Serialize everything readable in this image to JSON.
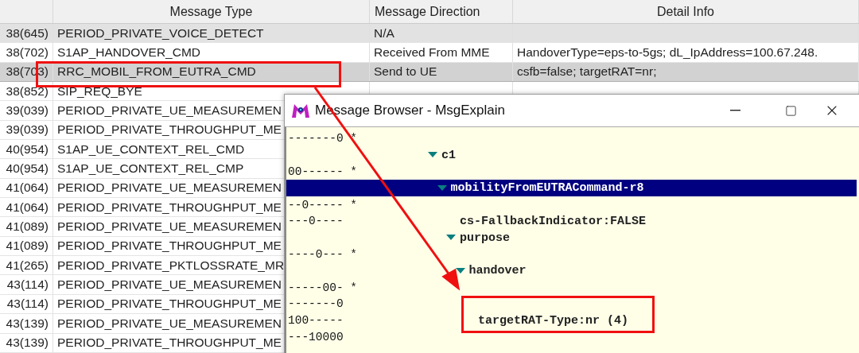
{
  "table": {
    "columns": [
      "Message Type",
      "Message Direction",
      "Detail Info"
    ],
    "rows": [
      {
        "time": "38(645)",
        "type": "PERIOD_PRIVATE_VOICE_DETECT",
        "direction": "N/A",
        "highlighted": true,
        "selected": false
      },
      {
        "time": "38(702)",
        "type": "S1AP_HANDOVER_CMD",
        "direction": "Received From MME",
        "detail": "HandoverType=eps-to-5gs; dL_IpAddress=100.67.248.",
        "highlighted": false,
        "selected": false
      },
      {
        "time": "38(703)",
        "type": "RRC_MOBIL_FROM_EUTRA_CMD",
        "direction": "Send to UE",
        "detail": "csfb=false; targetRAT=nr;",
        "highlighted": false,
        "selected": true
      },
      {
        "time": "38(852)",
        "type": "SIP_REQ_BYE",
        "highlighted": false,
        "selected": false
      },
      {
        "time": "39(039)",
        "type": "PERIOD_PRIVATE_UE_MEASUREMEN",
        "highlighted": false,
        "selected": false
      },
      {
        "time": "39(039)",
        "type": "PERIOD_PRIVATE_THROUGHPUT_ME",
        "highlighted": false,
        "selected": false
      },
      {
        "time": "40(954)",
        "type": "S1AP_UE_CONTEXT_REL_CMD",
        "highlighted": false,
        "selected": false
      },
      {
        "time": "40(954)",
        "type": "S1AP_UE_CONTEXT_REL_CMP",
        "highlighted": false,
        "selected": false
      },
      {
        "time": "41(064)",
        "type": "PERIOD_PRIVATE_UE_MEASUREMEN",
        "highlighted": false,
        "selected": false
      },
      {
        "time": "41(064)",
        "type": "PERIOD_PRIVATE_THROUGHPUT_ME",
        "highlighted": false,
        "selected": false
      },
      {
        "time": "41(089)",
        "type": "PERIOD_PRIVATE_UE_MEASUREMEN",
        "highlighted": false,
        "selected": false
      },
      {
        "time": "41(089)",
        "type": "PERIOD_PRIVATE_THROUGHPUT_ME",
        "highlighted": false,
        "selected": false
      },
      {
        "time": "41(265)",
        "type": "PERIOD_PRIVATE_PKTLOSSRATE_MR",
        "highlighted": false,
        "selected": false
      },
      {
        "time": "43(114)",
        "type": "PERIOD_PRIVATE_UE_MEASUREMEN",
        "highlighted": false,
        "selected": false
      },
      {
        "time": "43(114)",
        "type": "PERIOD_PRIVATE_THROUGHPUT_ME",
        "highlighted": false,
        "selected": false
      },
      {
        "time": "43(139)",
        "type": "PERIOD_PRIVATE_UE_MEASUREMEN",
        "highlighted": false,
        "selected": false
      },
      {
        "time": "43(139)",
        "type": "PERIOD_PRIVATE_THROUGHPUT_ME",
        "highlighted": false,
        "selected": false
      }
    ]
  },
  "dialog": {
    "title": "Message Browser - MsgExplain",
    "tree": [
      {
        "label": "c1",
        "pre": [
          "-------0 *"
        ],
        "expanded": true,
        "selected": false,
        "children": [
          {
            "label": "mobilityFromEUTRACommand-r8",
            "pre": [
              "00------ *"
            ],
            "expanded": true,
            "selected": true,
            "children": [
              {
                "label": "cs-FallbackIndicator:FALSE",
                "pre": [
                  "--0----- *"
                ],
                "bits": "---0----",
                "selected": false
              },
              {
                "label": "purpose",
                "expanded": true,
                "selected": false,
                "children": [
                  {
                    "label": "handover",
                    "pre": [
                      "----0--- *"
                    ],
                    "expanded": true,
                    "selected": false,
                    "children": [
                      {
                        "label": "targetRAT-Type:nr (4)",
                        "pre": [
                          "-----00- *",
                          "-------0"
                        ],
                        "bits": "100-----",
                        "post": [
                          "---10000"
                        ],
                        "selected": false
                      }
                    ]
                  }
                ]
              }
            ]
          }
        ]
      }
    ]
  }
}
